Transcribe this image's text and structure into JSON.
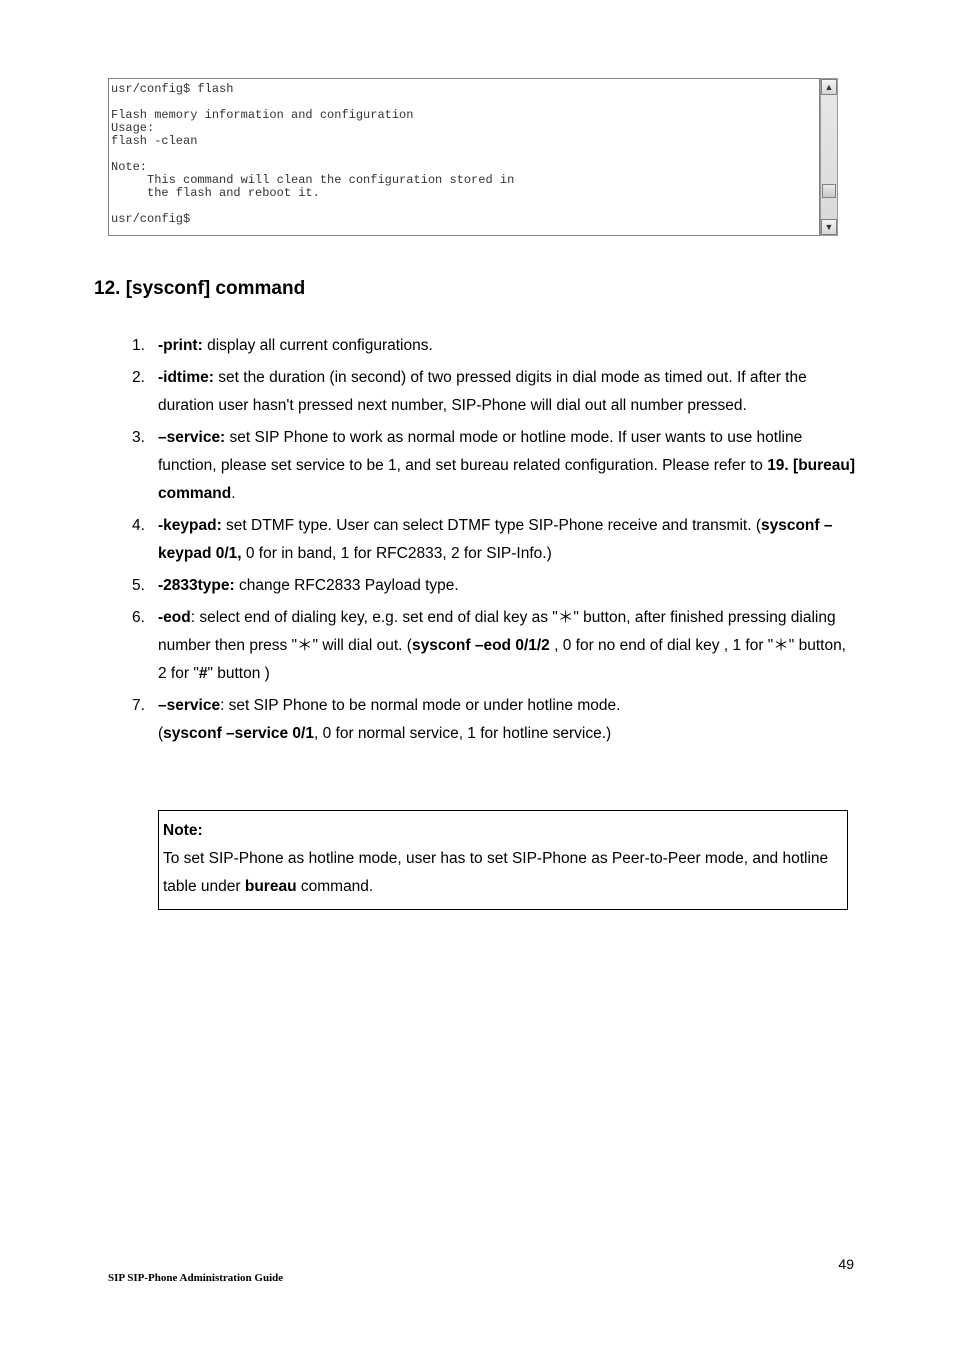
{
  "terminal": {
    "text": "usr/config$ flash\n\nFlash memory information and configuration\nUsage:\nflash -clean\n\nNote:\n     This command will clean the configuration stored in\n     the flash and reboot it.\n\nusr/config$"
  },
  "scrollbar": {
    "up_glyph": "▲",
    "down_glyph": "▼"
  },
  "heading": "12. [sysconf] command",
  "items": {
    "n1": "1.",
    "i1_bold": "-print:",
    "i1_rest": " display all current configurations.",
    "n2": "2.",
    "i2_bold": "-idtime:",
    "i2_rest": " set the duration (in second) of two pressed digits in dial mode as timed out. If after the duration user hasn't pressed next number, SIP-Phone will dial out all number pressed.",
    "n3": "3.",
    "i3_bold": "–service:",
    "i3_rest_a": " set SIP Phone to work as normal mode or hotline mode. If user wants to use hotline function, please set service to be 1, and set bureau related configuration. Please refer to ",
    "i3_rest_b_bold": "19. [bureau] command",
    "i3_rest_c": ".",
    "n4": "4.",
    "i4_bold": "-keypad:",
    "i4_rest_a": " set DTMF type. User can select DTMF type SIP-Phone receive and transmit. (",
    "i4_rest_b_bold": "sysconf –keypad 0/1,",
    "i4_rest_c": " 0 for in band, 1 for RFC2833, 2 for SIP-Info.)",
    "n5": "5.",
    "i5_bold": "-2833type:",
    "i5_rest": " change RFC2833 Payload type.",
    "n6": "6.",
    "i6_bold": "-eod",
    "i6_rest_a": ": select end of dialing key, e.g. set end of dial key as \"＊\" button, after finished pressing dialing number then press \"＊\" will dial out. (",
    "i6_rest_b_bold": "sysconf –eod 0/1/2",
    "i6_rest_c": " , 0 for no end of dial key , 1 for \"＊\" button, 2 for \"",
    "i6_rest_d_bold": "#",
    "i6_rest_e": "\" button )",
    "n7": "7.",
    "i7_bold": "–service",
    "i7_rest_a": ": set SIP Phone to be normal mode or under hotline mode.",
    "i7_line2_a": "(",
    "i7_line2_b_bold": "sysconf –service 0/1",
    "i7_line2_c": ", 0 for normal service, 1 for hotline service.)"
  },
  "note": {
    "title": "Note:",
    "body_a": "To set SIP-Phone as hotline mode, user has to set SIP-Phone as Peer-to-Peer mode, and hotline table under ",
    "body_b_bold": "bureau",
    "body_c": " command."
  },
  "footer": {
    "left": "SIP SIP-Phone   Administration Guide",
    "right": "49"
  }
}
